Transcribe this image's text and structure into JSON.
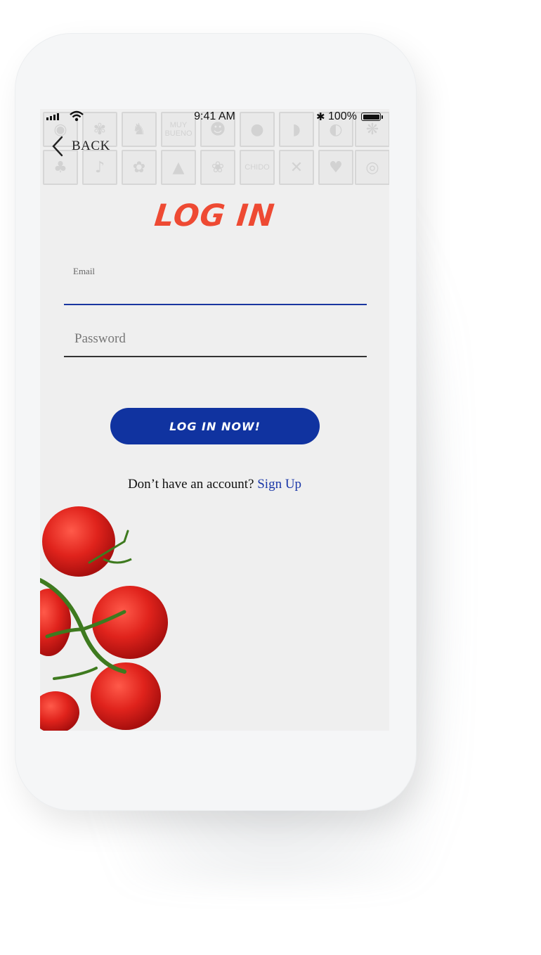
{
  "status_bar": {
    "time": "9:41 AM",
    "battery_percent": "100%",
    "battery_level": 1.0
  },
  "header": {
    "back_label": "BACK",
    "pattern_tiles": [
      "MUY BUENO",
      "CHIDO"
    ]
  },
  "title": "LOG IN",
  "form": {
    "email_label": "Email",
    "email_value": "",
    "password_placeholder": "Password",
    "password_value": "",
    "submit_label": "LOG IN NOW!"
  },
  "signup": {
    "prompt": "Don’t have an account?",
    "link_label": "Sign Up"
  },
  "colors": {
    "title": "#ee4a33",
    "button": "#1033a0",
    "link": "#1a37a8",
    "email_underline": "#1a36a0",
    "screen_bg": "#efefef"
  }
}
